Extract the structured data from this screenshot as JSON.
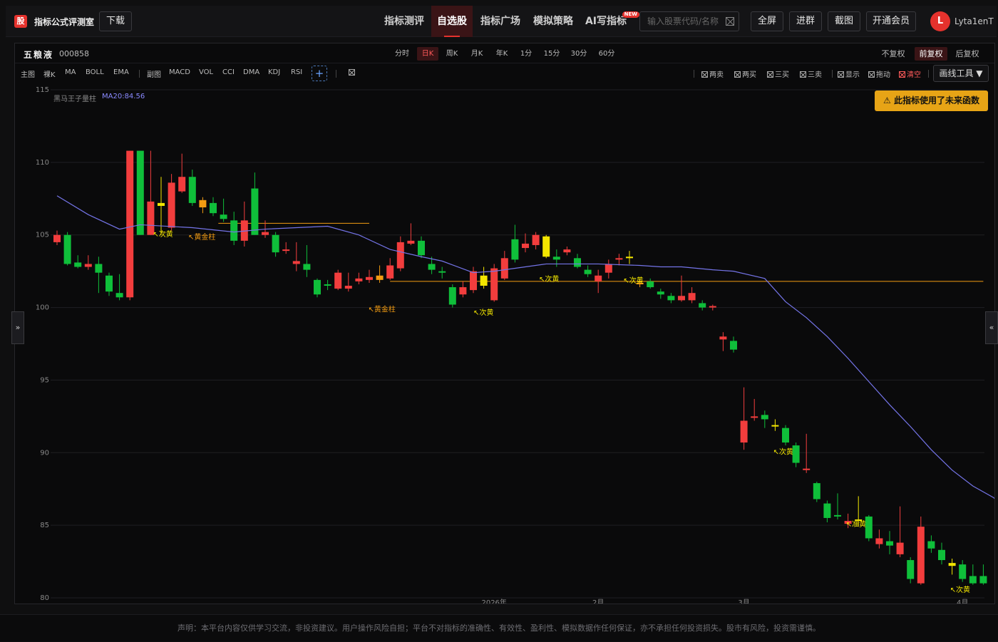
{
  "app": {
    "logo": "股",
    "title": "指标公式评测室",
    "download": "下载"
  },
  "nav": [
    {
      "label": "指标测评",
      "active": false
    },
    {
      "label": "自选股",
      "active": true
    },
    {
      "label": "指标广场",
      "active": false
    },
    {
      "label": "模拟策略",
      "active": false
    },
    {
      "label": "AI写指标",
      "active": false,
      "badge": "NEW"
    }
  ],
  "search": {
    "placeholder": "输入股票代码/名称"
  },
  "header_buttons": [
    "全屏",
    "进群",
    "截图",
    "开通会员"
  ],
  "user": {
    "initial": "L",
    "name": "Lyta1enT"
  },
  "stock": {
    "name": "五粮液",
    "code": "000858"
  },
  "periods": [
    {
      "label": "分时",
      "active": false
    },
    {
      "label": "日K",
      "active": true
    },
    {
      "label": "周K",
      "active": false
    },
    {
      "label": "月K",
      "active": false
    },
    {
      "label": "年K",
      "active": false
    },
    {
      "label": "1分",
      "active": false
    },
    {
      "label": "15分",
      "active": false
    },
    {
      "label": "30分",
      "active": false
    },
    {
      "label": "60分",
      "active": false
    }
  ],
  "adjust": [
    {
      "label": "不复权",
      "active": false
    },
    {
      "label": "前复权",
      "active": true
    },
    {
      "label": "后复权",
      "active": false
    }
  ],
  "main_indicators": {
    "label": "主图",
    "items": [
      "裸K",
      "MA",
      "BOLL",
      "EMA"
    ]
  },
  "sub_indicators": {
    "label": "副图",
    "items": [
      "MACD",
      "VOL",
      "CCI",
      "DMA",
      "KDJ",
      "RSI"
    ]
  },
  "signal_toggles": [
    {
      "label": "两卖",
      "color": "#bbbbbb"
    },
    {
      "label": "两买",
      "color": "#bbbbbb"
    },
    {
      "label": "三买",
      "color": "#bbbbbb"
    },
    {
      "label": "三卖",
      "color": "#bbbbbb"
    },
    {
      "label": "显示",
      "color": "#bbbbbb"
    },
    {
      "label": "拖动",
      "color": "#bbbbbb"
    },
    {
      "label": "清空",
      "color": "#ff5a5a"
    }
  ],
  "draw_tools": "画线工具 ▼",
  "warning": "⚠ 此指标使用了未来函数",
  "legend": {
    "indicator": "黑马王子量柱",
    "ma": "MA20:84.56"
  },
  "side_tabs": {
    "left": "»",
    "right": "«"
  },
  "footer": "声明：本平台内容仅供学习交流，非投资建议。用户操作风险自担；平台不对指标的准确性、有效性、盈利性、模拟数据作任何保证，亦不承担任何投资损失。股市有风险，投资需谨慎。",
  "colors": {
    "up": "#f23d3d",
    "down": "#0fbf3a",
    "gold": "#f3e600",
    "orange": "#f39c12",
    "ma": "#7474e8",
    "accent": "#e5322d"
  },
  "chart_data": {
    "type": "candlestick",
    "ylim": [
      80,
      115
    ],
    "y_ticks": [
      80,
      85,
      90,
      95,
      100,
      105,
      110,
      115
    ],
    "x_labels": [
      {
        "label": "2026年",
        "index": 42
      },
      {
        "label": "2月",
        "index": 52
      },
      {
        "label": "3月",
        "index": 66
      },
      {
        "label": "4月",
        "index": 87
      }
    ],
    "candles": [
      [
        105,
        104.5,
        105.3,
        104.3,
        "up"
      ],
      [
        105,
        103.0,
        105.2,
        102.9,
        "down"
      ],
      [
        103.1,
        102.8,
        103.6,
        102.7,
        "down"
      ],
      [
        102.8,
        103.0,
        103.6,
        102.6,
        "up"
      ],
      [
        103.0,
        102.4,
        103.5,
        101.0,
        "down"
      ],
      [
        102.2,
        101.1,
        102.4,
        100.8,
        "down"
      ],
      [
        101.0,
        100.7,
        102.3,
        100.5,
        "down"
      ],
      [
        100.7,
        110.8,
        110.8,
        100.5,
        "up"
      ],
      [
        110.8,
        105.0,
        110.8,
        105.0,
        "down"
      ],
      [
        105.0,
        107.3,
        110.8,
        105.0,
        "up"
      ],
      [
        107.0,
        107.2,
        109.0,
        105.0,
        "gold"
      ],
      [
        105.5,
        108.6,
        109.2,
        105.3,
        "up"
      ],
      [
        108.0,
        109.0,
        110.6,
        107.9,
        "up"
      ],
      [
        109.0,
        107.2,
        109.5,
        107.0,
        "down"
      ],
      [
        106.9,
        107.4,
        107.6,
        106.5,
        "orange"
      ],
      [
        107.2,
        106.5,
        107.6,
        106.3,
        "down"
      ],
      [
        106.4,
        106.1,
        107.5,
        105.9,
        "down"
      ],
      [
        106.0,
        104.6,
        106.6,
        104.3,
        "down"
      ],
      [
        104.6,
        106.0,
        107.3,
        104.2,
        "up"
      ],
      [
        105.0,
        108.2,
        109.3,
        105.0,
        "down"
      ],
      [
        105.0,
        105.2,
        106.0,
        104.8,
        "up"
      ],
      [
        105.0,
        103.8,
        105.2,
        103.5,
        "down"
      ],
      [
        103.9,
        104.0,
        104.5,
        103.7,
        "up"
      ],
      [
        103.0,
        103.2,
        104.5,
        102.5,
        "up"
      ],
      [
        103.0,
        102.6,
        104.3,
        102.1,
        "down"
      ],
      [
        101.9,
        100.9,
        102.0,
        100.7,
        "down"
      ],
      [
        101.5,
        101.6,
        101.9,
        101.2,
        "down"
      ],
      [
        101.3,
        102.4,
        102.6,
        101.2,
        "up"
      ],
      [
        101.3,
        101.5,
        102.4,
        101.1,
        "up"
      ],
      [
        101.8,
        102.0,
        102.4,
        101.6,
        "up"
      ],
      [
        101.9,
        102.1,
        102.6,
        101.7,
        "up"
      ],
      [
        101.9,
        102.2,
        102.9,
        101.7,
        "orange"
      ],
      [
        102.0,
        102.9,
        103.4,
        101.9,
        "up"
      ],
      [
        102.7,
        104.5,
        104.9,
        102.5,
        "up"
      ],
      [
        104.4,
        104.6,
        105.8,
        104.3,
        "up"
      ],
      [
        104.6,
        103.6,
        104.9,
        103.4,
        "down"
      ],
      [
        103.0,
        102.6,
        103.5,
        102.3,
        "down"
      ],
      [
        102.4,
        102.5,
        102.8,
        102.0,
        "down"
      ],
      [
        101.4,
        100.2,
        101.6,
        100.0,
        "down"
      ],
      [
        100.9,
        101.4,
        101.8,
        100.7,
        "up"
      ],
      [
        101.2,
        102.5,
        102.8,
        101.0,
        "up"
      ],
      [
        101.5,
        102.2,
        102.8,
        101.3,
        "gold"
      ],
      [
        100.5,
        102.7,
        103.0,
        100.4,
        "up"
      ],
      [
        102.0,
        103.4,
        103.9,
        101.9,
        "up"
      ],
      [
        103.3,
        104.7,
        105.7,
        103.1,
        "down"
      ],
      [
        104.1,
        104.4,
        105.1,
        103.8,
        "up"
      ],
      [
        104.3,
        105.0,
        105.2,
        104.0,
        "up"
      ],
      [
        104.9,
        103.5,
        105.0,
        103.4,
        "gold"
      ],
      [
        103.5,
        103.3,
        104.0,
        102.8,
        "down"
      ],
      [
        103.8,
        104.0,
        104.2,
        103.6,
        "up"
      ],
      [
        103.4,
        102.8,
        103.7,
        102.7,
        "down"
      ],
      [
        102.6,
        102.3,
        102.9,
        102.1,
        "down"
      ],
      [
        101.8,
        102.2,
        102.6,
        101.0,
        "up"
      ],
      [
        102.4,
        103.0,
        103.3,
        102.0,
        "up"
      ],
      [
        103.4,
        103.3,
        103.7,
        102.9,
        "up"
      ],
      [
        103.5,
        103.4,
        103.9,
        103.0,
        "gold"
      ],
      [
        101.6,
        101.7,
        101.9,
        101.4,
        "orange"
      ],
      [
        101.8,
        101.4,
        102.0,
        101.3,
        "down"
      ],
      [
        101.1,
        100.9,
        101.3,
        100.6,
        "down"
      ],
      [
        100.8,
        100.5,
        101.0,
        100.3,
        "down"
      ],
      [
        100.5,
        100.8,
        102.2,
        100.4,
        "up"
      ],
      [
        100.5,
        101.0,
        101.4,
        100.3,
        "up"
      ],
      [
        100.3,
        100.0,
        100.5,
        99.8,
        "down"
      ],
      [
        100.0,
        100.1,
        100.2,
        99.8,
        "up"
      ],
      [
        97.8,
        98.0,
        98.3,
        97.0,
        "up"
      ],
      [
        97.7,
        97.1,
        98.0,
        96.9,
        "down"
      ],
      [
        90.7,
        92.2,
        94.5,
        90.2,
        "up"
      ],
      [
        92.4,
        92.5,
        93.7,
        92.2,
        "up"
      ],
      [
        92.6,
        92.3,
        92.9,
        91.7,
        "down"
      ],
      [
        91.8,
        91.9,
        92.3,
        91.5,
        "gold"
      ],
      [
        91.7,
        90.7,
        91.9,
        90.5,
        "down"
      ],
      [
        90.5,
        89.3,
        90.7,
        89.0,
        "down"
      ],
      [
        88.8,
        88.9,
        91.3,
        88.6,
        "up"
      ],
      [
        87.9,
        86.8,
        88.0,
        86.6,
        "down"
      ],
      [
        86.5,
        85.5,
        86.7,
        85.2,
        "down"
      ],
      [
        85.6,
        85.7,
        87.2,
        85.4,
        "down"
      ],
      [
        85.1,
        85.3,
        85.8,
        84.8,
        "up"
      ],
      [
        85.3,
        85.4,
        87.0,
        84.9,
        "gold"
      ],
      [
        85.6,
        84.1,
        85.7,
        83.9,
        "down"
      ],
      [
        83.7,
        84.1,
        84.7,
        83.4,
        "up"
      ],
      [
        83.9,
        83.6,
        84.6,
        83.0,
        "down"
      ],
      [
        83.0,
        83.8,
        86.3,
        82.8,
        "up"
      ],
      [
        81.3,
        82.6,
        82.8,
        81.0,
        "down"
      ],
      [
        81.0,
        84.9,
        85.6,
        80.9,
        "up"
      ],
      [
        83.9,
        83.4,
        84.3,
        83.1,
        "down"
      ],
      [
        83.3,
        82.6,
        83.8,
        82.3,
        "down"
      ],
      [
        82.4,
        82.2,
        82.7,
        81.6,
        "gold"
      ],
      [
        82.3,
        81.3,
        82.6,
        81.1,
        "down"
      ],
      [
        81.5,
        81.0,
        82.3,
        80.9,
        "down"
      ],
      [
        81.5,
        81.0,
        82.3,
        80.9,
        "down"
      ]
    ],
    "ma20": [
      [
        0,
        107.7
      ],
      [
        3,
        106.4
      ],
      [
        6,
        105.4
      ],
      [
        8,
        105.7
      ],
      [
        13,
        105.5
      ],
      [
        17,
        105.2
      ],
      [
        20,
        105.4
      ],
      [
        23,
        105.5
      ],
      [
        26,
        105.6
      ],
      [
        29,
        105.0
      ],
      [
        32,
        104.0
      ],
      [
        35,
        103.5
      ],
      [
        37,
        103.2
      ],
      [
        40,
        102.4
      ],
      [
        42,
        102.5
      ],
      [
        45,
        102.8
      ],
      [
        47,
        103.0
      ],
      [
        49,
        103.0
      ],
      [
        52,
        103.0
      ],
      [
        56,
        102.9
      ],
      [
        58,
        102.8
      ],
      [
        60,
        102.8
      ],
      [
        63,
        102.6
      ],
      [
        65,
        102.5
      ],
      [
        68,
        102.0
      ],
      [
        70,
        100.4
      ],
      [
        72,
        99.3
      ],
      [
        74,
        98.0
      ],
      [
        76,
        96.5
      ],
      [
        78,
        94.9
      ],
      [
        80,
        93.3
      ],
      [
        82,
        91.8
      ],
      [
        84,
        90.2
      ],
      [
        86,
        88.8
      ],
      [
        88,
        87.7
      ],
      [
        90,
        86.9
      ],
      [
        93,
        84.6
      ]
    ],
    "orange_lines": [
      {
        "y": 105.8,
        "from": 15.5,
        "to": 30
      },
      {
        "y": 101.8,
        "from": 32,
        "to": 89
      }
    ],
    "annotations": [
      {
        "text": "↖次黄",
        "index": 9.2,
        "y": 104.9,
        "color": "#f3e600"
      },
      {
        "text": "↖黄金柱",
        "index": 12.6,
        "y": 104.7,
        "color": "#f39c12"
      },
      {
        "text": "↖黄金柱",
        "index": 29.9,
        "y": 99.7,
        "color": "#f39c12"
      },
      {
        "text": "↖次黄",
        "index": 40.0,
        "y": 99.5,
        "color": "#f3e600"
      },
      {
        "text": "↖次黄",
        "index": 46.3,
        "y": 101.8,
        "color": "#f3e600"
      },
      {
        "text": "↖次黄",
        "index": 54.4,
        "y": 101.7,
        "color": "#f3e600"
      },
      {
        "text": "↖次黄",
        "index": 68.8,
        "y": 89.9,
        "color": "#f3e600"
      },
      {
        "text": "↖准黄",
        "index": 75.8,
        "y": 84.9,
        "color": "#f3e600"
      },
      {
        "text": "↖次黄",
        "index": 85.8,
        "y": 80.4,
        "color": "#f3e600"
      }
    ]
  }
}
